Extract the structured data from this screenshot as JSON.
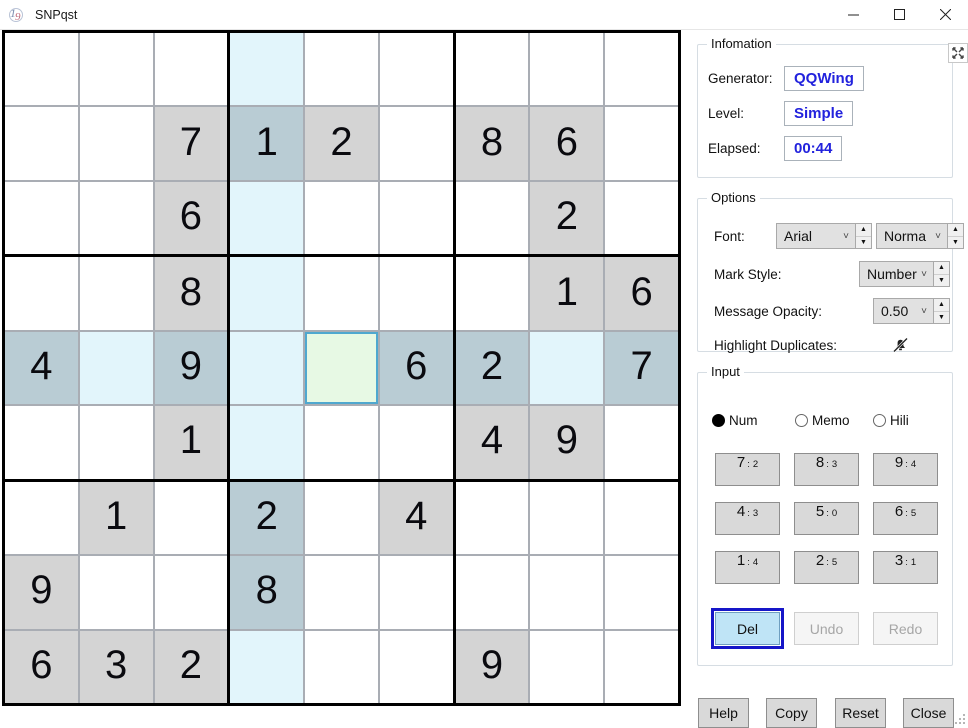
{
  "window": {
    "title": "SNPqst",
    "icon": "sudoku-app-icon",
    "minimize": "minimize-icon",
    "maximize": "maximize-icon",
    "close": "close-icon"
  },
  "board": {
    "selected": {
      "row": 4,
      "col": 4
    },
    "highlight_row": 4,
    "highlight_col": 3,
    "colors": {
      "given_bg": "#d4d4d4",
      "empty_bg": "#ffffff",
      "highlight_bg": "#e2f5fb",
      "given_highlight_bg": "#b9ccd4",
      "selected_bg": "#e7f9e4",
      "selected_border": "#4fa8cf",
      "digit": "#0a0a0f"
    },
    "cells": [
      [
        "",
        "",
        "",
        "",
        "",
        "",
        "",
        "",
        ""
      ],
      [
        "",
        "",
        "7",
        "1",
        "2",
        "",
        "8",
        "6",
        ""
      ],
      [
        "",
        "",
        "6",
        "",
        "",
        "",
        "",
        "2",
        ""
      ],
      [
        "",
        "",
        "8",
        "",
        "",
        "",
        "",
        "1",
        "6"
      ],
      [
        "4",
        "",
        "9",
        "",
        "",
        "6",
        "2",
        "",
        "7"
      ],
      [
        "",
        "",
        "1",
        "",
        "",
        "",
        "4",
        "9",
        ""
      ],
      [
        "",
        "1",
        "",
        "2",
        "",
        "4",
        "",
        "",
        ""
      ],
      [
        "9",
        "",
        "",
        "8",
        "",
        "",
        "",
        "",
        ""
      ],
      [
        "6",
        "3",
        "2",
        "",
        "",
        "",
        "9",
        "",
        ""
      ]
    ]
  },
  "information": {
    "legend": "Infomation",
    "fit_icon": "fit-to-window-icon",
    "rows": [
      {
        "label": "Generator:",
        "value": "QQWing"
      },
      {
        "label": "Level:",
        "value": "Simple"
      },
      {
        "label": "Elapsed:",
        "value": "00:44"
      }
    ]
  },
  "options": {
    "legend": "Options",
    "font_label": "Font:",
    "font_family": "Arial",
    "font_style": "Norma",
    "mark_style_label": "Mark Style:",
    "mark_style": "Number",
    "message_opacity_label": "Message Opacity:",
    "message_opacity": "0.50",
    "highlight_duplicates_label": "Highlight Duplicates:",
    "highlight_duplicates_icon": "bell-off-icon",
    "chevron": "˅",
    "spin_up": "▲",
    "spin_down": "▼"
  },
  "input": {
    "legend": "Input",
    "modes": [
      {
        "label": "Num",
        "selected": true
      },
      {
        "label": "Memo",
        "selected": false
      },
      {
        "label": "Hili",
        "selected": false
      }
    ],
    "numbers": [
      {
        "digit": "7",
        "count": "2"
      },
      {
        "digit": "8",
        "count": "3"
      },
      {
        "digit": "9",
        "count": "4"
      },
      {
        "digit": "4",
        "count": "3"
      },
      {
        "digit": "5",
        "count": "0"
      },
      {
        "digit": "6",
        "count": "5"
      },
      {
        "digit": "1",
        "count": "4"
      },
      {
        "digit": "2",
        "count": "5"
      },
      {
        "digit": "3",
        "count": "1"
      }
    ],
    "separator": ":",
    "del": "Del",
    "undo": "Undo",
    "redo": "Redo"
  },
  "bottom": {
    "help": "Help",
    "copy": "Copy",
    "reset": "Reset",
    "close": "Close"
  }
}
